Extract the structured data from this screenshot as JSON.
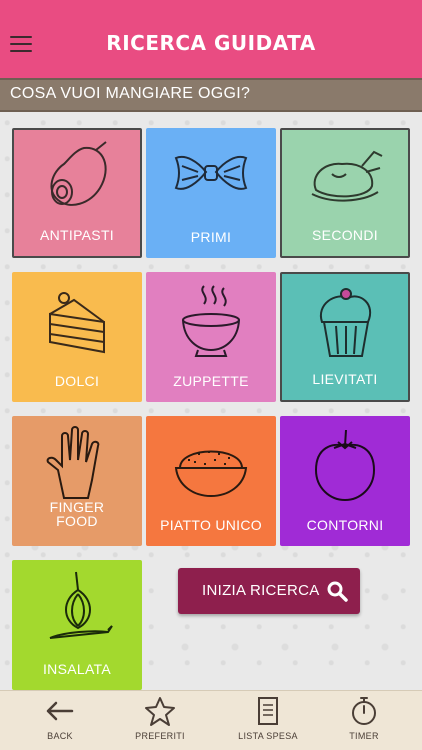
{
  "header": {
    "title": "RICERCA GUIDATA",
    "menu_icon": "hamburger-menu-icon"
  },
  "question": "COSA VUOI MANGIARE OGGI?",
  "categories": [
    {
      "label": "ANTIPASTI",
      "color": "#e7819a",
      "icon": "ham-icon"
    },
    {
      "label": "PRIMI",
      "color": "#6ab0f5",
      "icon": "pasta-icon"
    },
    {
      "label": "SECONDI",
      "color": "#9ad3ad",
      "icon": "roast-chicken-icon"
    },
    {
      "label": "DOLCI",
      "color": "#f9bb4e",
      "icon": "cake-slice-icon"
    },
    {
      "label": "ZUPPETTE",
      "color": "#e17fc0",
      "icon": "soup-bowl-icon"
    },
    {
      "label": "LIEVITATI",
      "color": "#5bbfb6",
      "icon": "muffin-icon"
    },
    {
      "label": "FINGER\nFOOD",
      "color": "#e69b68",
      "icon": "hand-icon"
    },
    {
      "label": "PIATTO UNICO",
      "color": "#f5773f",
      "icon": "rice-bowl-icon"
    },
    {
      "label": "CONTORNI",
      "color": "#a02bd6",
      "icon": "tomato-icon"
    },
    {
      "label": "INSALATA",
      "color": "#a3d92e",
      "icon": "onion-carrot-icon"
    }
  ],
  "search_button": {
    "label": "INIZIA RICERCA",
    "icon": "search-icon"
  },
  "tabbar": [
    {
      "label": "BACK",
      "icon": "back-arrow-icon"
    },
    {
      "label": "PREFERITI",
      "icon": "star-icon"
    },
    {
      "label": "LISTA SPESA",
      "icon": "notepad-icon"
    },
    {
      "label": "TIMER",
      "icon": "stopwatch-icon"
    }
  ]
}
